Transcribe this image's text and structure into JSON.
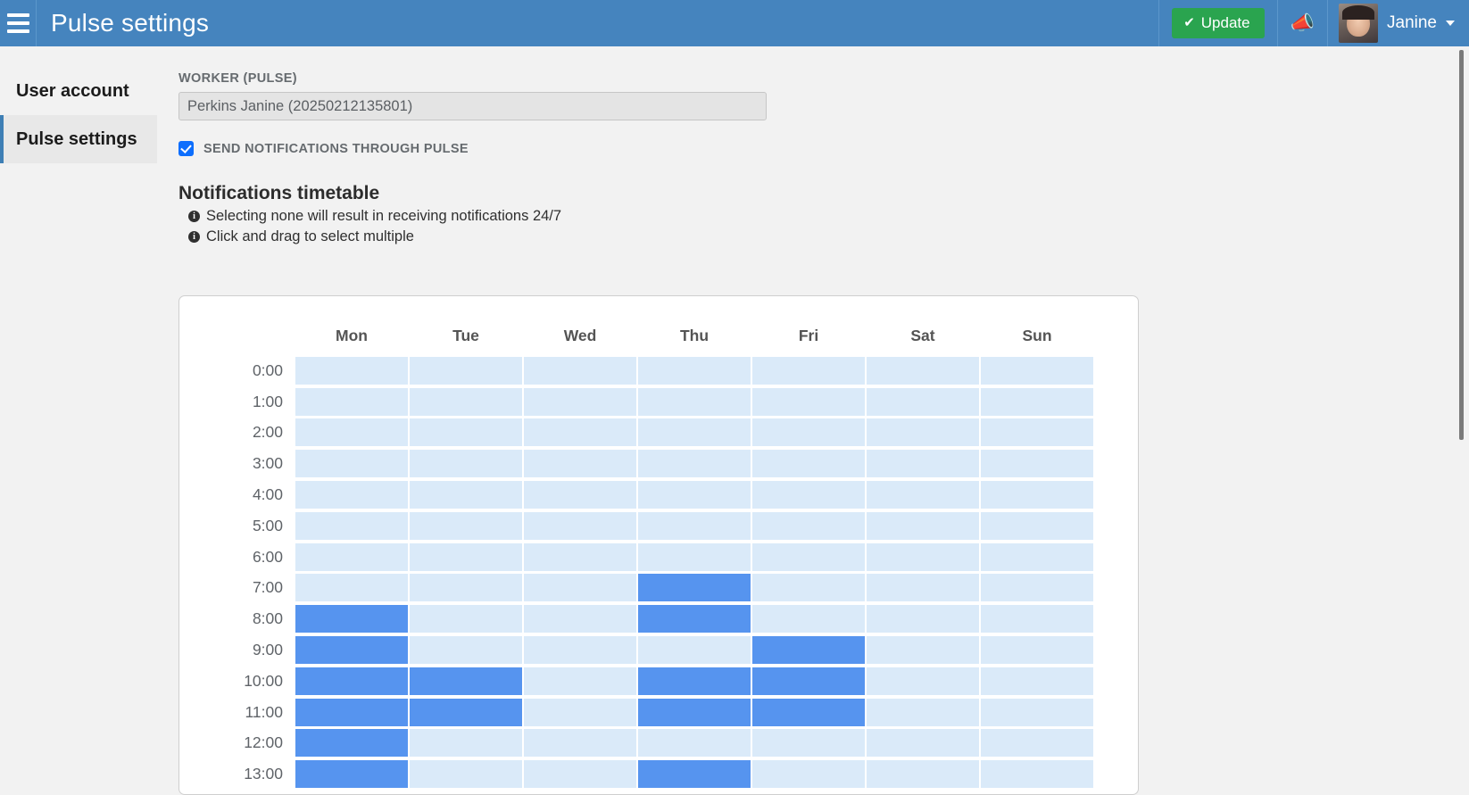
{
  "topbar": {
    "menu_icon": "hamburger-icon",
    "title": "Pulse settings",
    "update_label": "Update",
    "update_icon": "check-icon",
    "update_color": "#2aa44f",
    "announcement_icon": "megaphone-icon",
    "username": "Janine",
    "bar_color": "#4584be"
  },
  "sidebar": {
    "items": [
      {
        "label": "User account",
        "active": false
      },
      {
        "label": "Pulse settings",
        "active": true
      }
    ]
  },
  "main": {
    "worker_label": "WORKER (PULSE)",
    "worker_value": "Perkins Janine (20250212135801)",
    "notifications_checkbox_label": "SEND NOTIFICATIONS THROUGH PULSE",
    "notifications_checked": true,
    "timetable_title": "Notifications timetable",
    "hints": [
      "Selecting none will result in receiving notifications 24/7",
      "Click and drag to select multiple"
    ]
  },
  "timetable": {
    "days": [
      "Mon",
      "Tue",
      "Wed",
      "Thu",
      "Fri",
      "Sat",
      "Sun"
    ],
    "hours": [
      "0:00",
      "1:00",
      "2:00",
      "3:00",
      "4:00",
      "5:00",
      "6:00",
      "7:00",
      "8:00",
      "9:00",
      "10:00",
      "11:00",
      "12:00",
      "13:00"
    ],
    "selected_color": "#5694ef",
    "unselected_color": "#daeaf9",
    "selection": [
      [
        false,
        false,
        false,
        false,
        false,
        false,
        false
      ],
      [
        false,
        false,
        false,
        false,
        false,
        false,
        false
      ],
      [
        false,
        false,
        false,
        false,
        false,
        false,
        false
      ],
      [
        false,
        false,
        false,
        false,
        false,
        false,
        false
      ],
      [
        false,
        false,
        false,
        false,
        false,
        false,
        false
      ],
      [
        false,
        false,
        false,
        false,
        false,
        false,
        false
      ],
      [
        false,
        false,
        false,
        false,
        false,
        false,
        false
      ],
      [
        false,
        false,
        false,
        true,
        false,
        false,
        false
      ],
      [
        true,
        false,
        false,
        true,
        false,
        false,
        false
      ],
      [
        true,
        false,
        false,
        false,
        true,
        false,
        false
      ],
      [
        true,
        true,
        false,
        true,
        true,
        false,
        false
      ],
      [
        true,
        true,
        false,
        true,
        true,
        false,
        false
      ],
      [
        true,
        false,
        false,
        false,
        false,
        false,
        false
      ],
      [
        true,
        false,
        false,
        true,
        false,
        false,
        false
      ]
    ]
  }
}
